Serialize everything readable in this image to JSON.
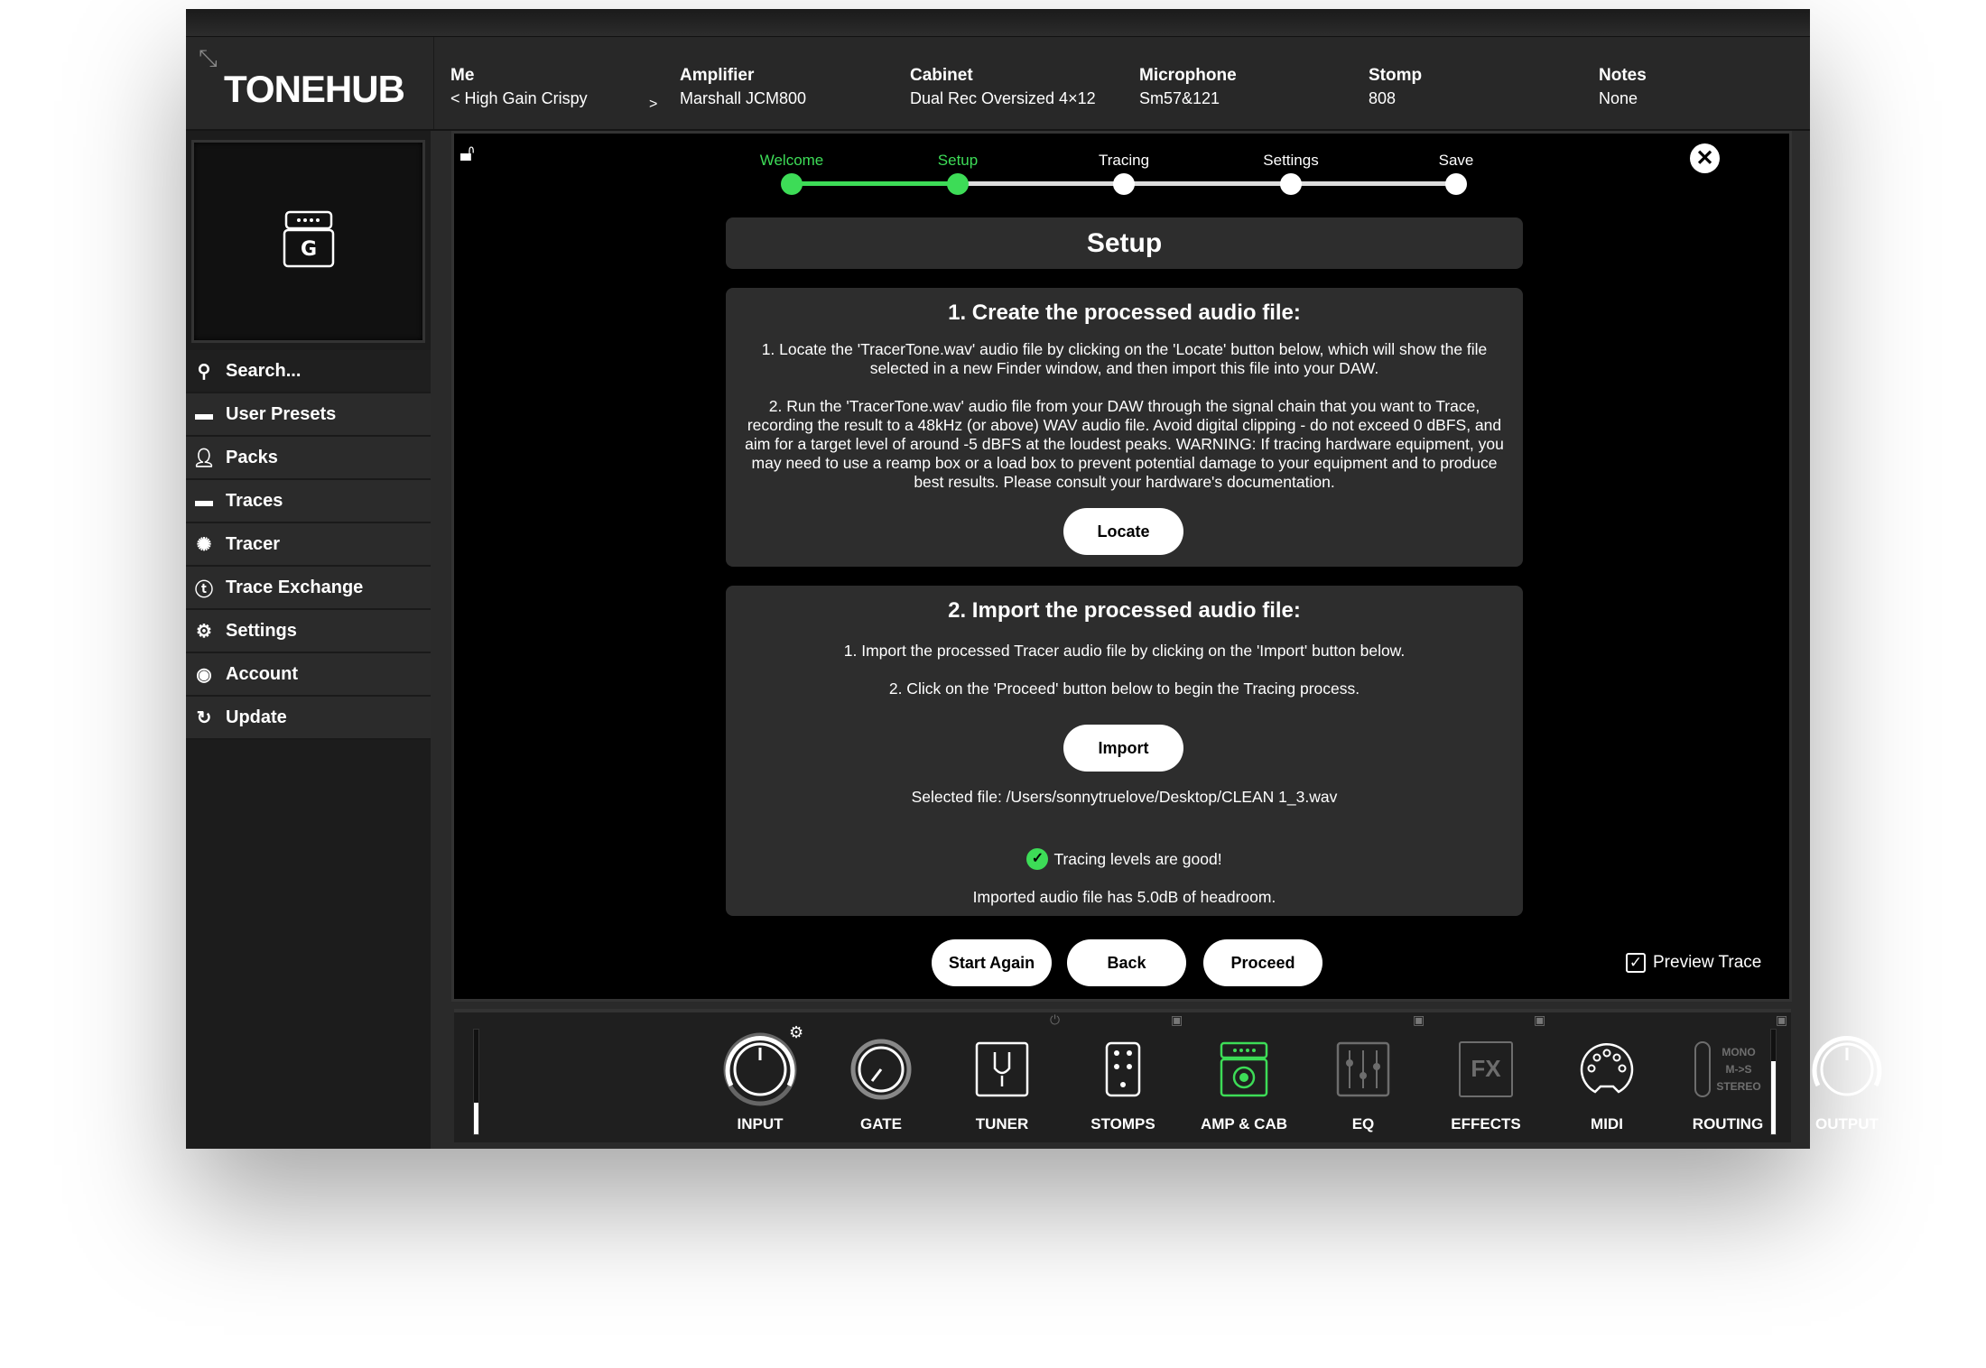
{
  "app": {
    "logo": "TONEHUB"
  },
  "header": {
    "fields": [
      {
        "label": "Me",
        "value": "High Gain Crispy",
        "prev": "<",
        "next": ">"
      },
      {
        "label": "Amplifier",
        "value": "Marshall JCM800"
      },
      {
        "label": "Cabinet",
        "value": "Dual Rec Oversized 4×12"
      },
      {
        "label": "Microphone",
        "value": "Sm57&121"
      },
      {
        "label": "Stomp",
        "value": "808"
      },
      {
        "label": "Notes",
        "value": "None"
      }
    ]
  },
  "sidebar": {
    "items": [
      {
        "label": "Search...",
        "icon": "search-icon"
      },
      {
        "label": "User Presets",
        "icon": "folder-icon"
      },
      {
        "label": "Packs",
        "icon": "user-icon"
      },
      {
        "label": "Traces",
        "icon": "folder-icon"
      },
      {
        "label": "Tracer",
        "icon": "tracer-icon"
      },
      {
        "label": "Trace Exchange",
        "icon": "trace-exchange-icon"
      },
      {
        "label": "Settings",
        "icon": "gear-icon"
      },
      {
        "label": "Account",
        "icon": "account-icon"
      },
      {
        "label": "Update",
        "icon": "update-icon"
      }
    ]
  },
  "wizard": {
    "steps": [
      "Welcome",
      "Setup",
      "Tracing",
      "Settings",
      "Save"
    ],
    "current_step": "Setup",
    "accent": "#3ddc57",
    "title": "Setup",
    "section1": {
      "title": "1. Create the processed audio file:",
      "p1": "1. Locate the 'TracerTone.wav' audio file by clicking on the 'Locate' button below, which will show the file selected in a new Finder window, and then import this file into your DAW.",
      "p2": "2. Run the 'TracerTone.wav' audio file from your DAW through the signal chain that you want to Trace, recording the result to a 48kHz (or above) WAV audio file. Avoid digital clipping - do not exceed 0 dBFS, and aim for a target level of around -5 dBFS at the loudest peaks. WARNING: If tracing hardware equipment, you may need to use a reamp box or a load box to prevent potential damage to your equipment and to produce best results. Please consult your hardware's documentation.",
      "button": "Locate"
    },
    "section2": {
      "title": "2. Import the processed audio file:",
      "p1": "1. Import the processed Tracer audio file by clicking on the 'Import' button below.",
      "p2": "2. Click on the 'Proceed' button below to begin the Tracing process.",
      "button": "Import",
      "selected_file": "Selected file: /Users/sonnytruelove/Desktop/CLEAN 1_3.wav",
      "status": "Tracing levels are good!",
      "headroom": "Imported audio file has 5.0dB of headroom."
    },
    "buttons": {
      "start_again": "Start Again",
      "back": "Back",
      "proceed": "Proceed"
    },
    "preview_trace": {
      "label": "Preview Trace",
      "checked": true
    }
  },
  "modules": [
    "INPUT",
    "GATE",
    "TUNER",
    "STOMPS",
    "AMP & CAB",
    "EQ",
    "EFFECTS",
    "MIDI",
    "ROUTING",
    "OUTPUT"
  ],
  "routing_options": [
    "MONO",
    "M->S",
    "STEREO"
  ],
  "fx_glyph": "FX"
}
